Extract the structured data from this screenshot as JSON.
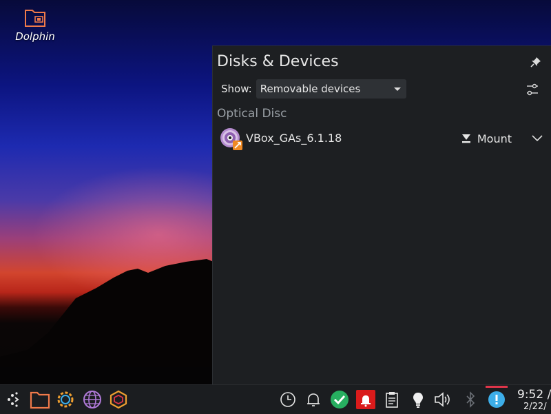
{
  "desktop": {
    "icons": [
      {
        "label": "Dolphin",
        "icon": "folder-icon"
      }
    ]
  },
  "panel": {
    "title": "Disks & Devices",
    "show_label": "Show:",
    "filter": {
      "selected": "Removable devices"
    },
    "sections": [
      {
        "header": "Optical Disc",
        "devices": [
          {
            "name": "VBox_GAs_6.1.18",
            "action_label": "Mount",
            "icon": "optical-disc-icon"
          }
        ]
      }
    ]
  },
  "taskbar": {
    "launchers": [
      "app-launcher-icon",
      "file-manager-icon",
      "settings-icon",
      "web-browser-icon",
      "package-icon"
    ],
    "tray": [
      "clock-icon",
      "notifications-icon",
      "updates-icon",
      "notification-alert-icon",
      "clipboard-icon",
      "night-color-icon",
      "volume-icon",
      "bluetooth-icon",
      "disks-devices-icon"
    ],
    "clock": {
      "time": "9:52 /",
      "date": "2/22/"
    }
  },
  "colors": {
    "panel_bg": "#1d1f22",
    "accent_green": "#27ae60",
    "alert_red": "#da1b1b",
    "info_blue": "#3daee9",
    "folder_orange": "#f07a4a"
  }
}
